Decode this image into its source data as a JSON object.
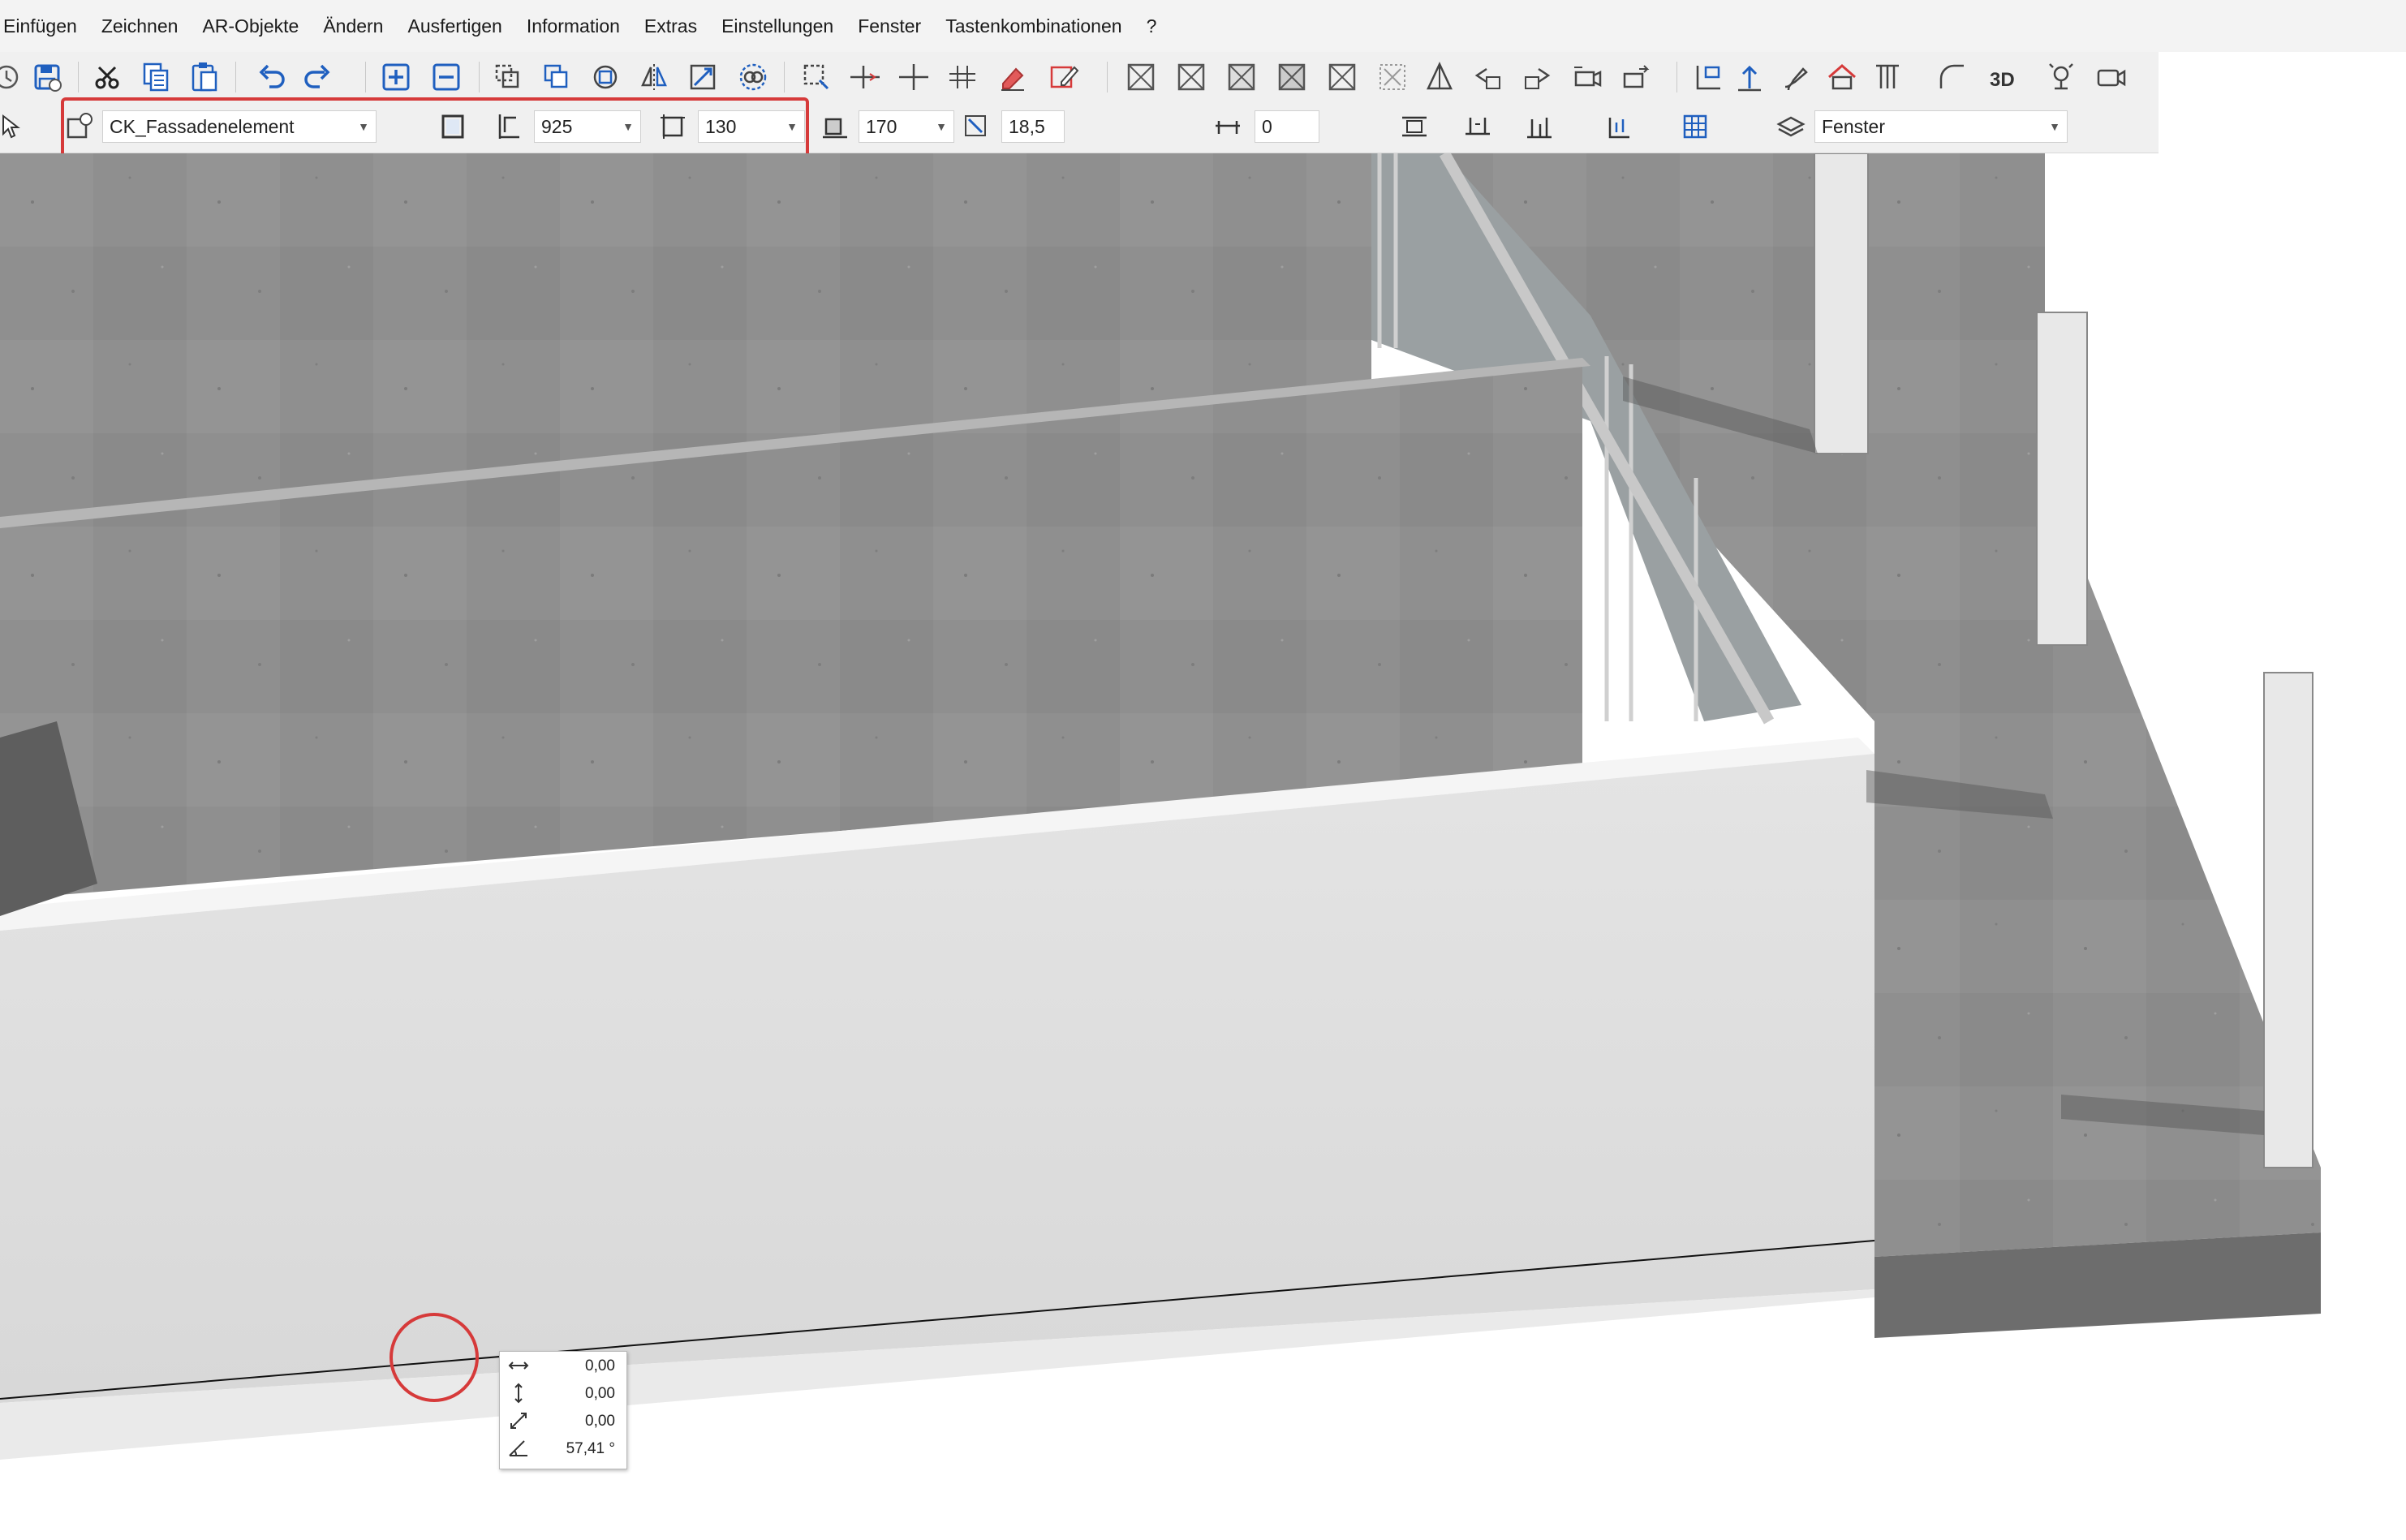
{
  "menu": [
    "Einfügen",
    "Zeichnen",
    "AR-Objekte",
    "Ändern",
    "Ausfertigen",
    "Information",
    "Extras",
    "Einstellungen",
    "Fenster",
    "Tastenkombinationen",
    "?"
  ],
  "toolbar": {
    "icons": [
      "history-icon",
      "save-icon",
      "cut-icon",
      "copy-icon",
      "paste-icon",
      "undo-icon",
      "redo-icon",
      "zoom-in-icon",
      "zoom-out-icon",
      "copy-object-icon",
      "duplicate-icon",
      "rotate-icon",
      "mirror-icon",
      "stretch-icon",
      "transform-icon",
      "align-icon",
      "split-line-icon",
      "intersect-icon",
      "divide-icon",
      "eraser-icon",
      "edit-pen-icon",
      "cross-box-icon-1",
      "cross-box-icon-2",
      "cross-box-icon-3",
      "cross-box-icon-4",
      "cross-box-icon-5",
      "cross-box-icon-6",
      "pyramid-icon",
      "arrow-back-icon",
      "arrow-forward-icon",
      "camera-move-icon",
      "camera-turn-icon",
      "layer-props-icon",
      "elevation-icon",
      "paint-brush-icon",
      "house-icon",
      "pillar-icon",
      "arc-icon",
      "view-3d-icon",
      "light-icon",
      "video-camera-icon"
    ],
    "view_3d_label": "3D"
  },
  "properties": {
    "element_name": "CK_Fassadenelement",
    "width_value": "925",
    "height_value": "130",
    "offset_value": "170",
    "slope_value": "18,5",
    "gap_value": "0",
    "layer_name": "Fenster"
  },
  "tooltip": {
    "dx": "0,00",
    "dy": "0,00",
    "dz": "0,00",
    "angle": "57,41 °"
  },
  "colors": {
    "highlight": "#d63a3a",
    "accent_blue": "#1f5fbf",
    "toolbar_bg": "#f0f0f0"
  }
}
